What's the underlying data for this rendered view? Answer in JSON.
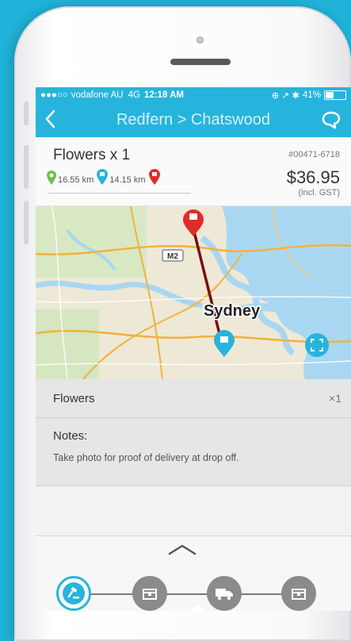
{
  "status_bar": {
    "signal": "●●●○○",
    "carrier": "vodafone AU",
    "network": "4G",
    "time": "12:18 AM",
    "icons": "⊕ ↗ ✱",
    "battery": "41%"
  },
  "nav": {
    "back_icon": "chevron-left-icon",
    "title": "Redfern > Chatswood",
    "chat_icon": "chat-bubble-icon"
  },
  "order": {
    "item_title": "Flowers x 1",
    "order_id": "#00471-6718",
    "distance_1": "16.55 km",
    "distance_2": "14.15 km",
    "price": "$36.95",
    "price_note": "(incl. GST)"
  },
  "map": {
    "city_label": "Sydney",
    "road_label": "M2",
    "pickup_pin_color": "#e02b2b",
    "dropoff_pin_color": "#27b4dc",
    "route_color": "#7a0f0f"
  },
  "items": [
    {
      "name": "Flowers",
      "qty": "×1"
    }
  ],
  "notes": {
    "title": "Notes:",
    "text": "Take photo for proof of delivery at drop off."
  },
  "steps": [
    {
      "name": "gavel-icon",
      "active": true
    },
    {
      "name": "package-icon",
      "active": false
    },
    {
      "name": "truck-icon",
      "active": false
    },
    {
      "name": "package-icon",
      "active": false
    }
  ],
  "colors": {
    "accent": "#27b4dc",
    "background": "#1fb3d9"
  }
}
